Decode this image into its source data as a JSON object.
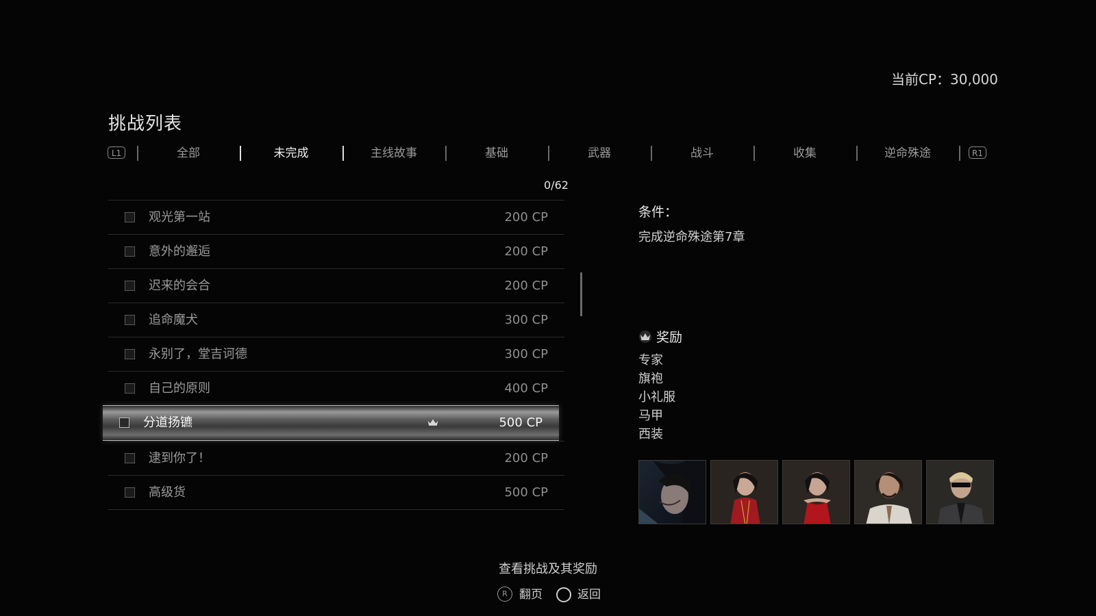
{
  "header": {
    "cp_label": "当前CP：30,000",
    "title": "挑战列表"
  },
  "tabs": {
    "left_trigger": "L1",
    "right_trigger": "R1",
    "items": [
      {
        "label": "全部",
        "active": false
      },
      {
        "label": "未完成",
        "active": true
      },
      {
        "label": "主线故事",
        "active": false
      },
      {
        "label": "基础",
        "active": false
      },
      {
        "label": "武器",
        "active": false
      },
      {
        "label": "战斗",
        "active": false
      },
      {
        "label": "收集",
        "active": false
      },
      {
        "label": "逆命殊途",
        "active": false
      }
    ]
  },
  "progress": "0/62",
  "challenges": [
    {
      "name": "观光第一站",
      "points": "200 CP",
      "selected": false
    },
    {
      "name": "意外的邂逅",
      "points": "200 CP",
      "selected": false
    },
    {
      "name": "迟来的会合",
      "points": "200 CP",
      "selected": false
    },
    {
      "name": "追命魔犬",
      "points": "300 CP",
      "selected": false
    },
    {
      "name": "永别了，堂吉诃德",
      "points": "300 CP",
      "selected": false
    },
    {
      "name": "自己的原则",
      "points": "400 CP",
      "selected": false
    },
    {
      "name": "分道扬镳",
      "points": "500 CP",
      "selected": true,
      "icon": "crown-icon"
    },
    {
      "name": "逮到你了！",
      "points": "200 CP",
      "selected": false
    },
    {
      "name": "高级货",
      "points": "500 CP",
      "selected": false
    }
  ],
  "detail": {
    "condition_label": "条件：",
    "condition_text": "完成逆命殊途第7章",
    "reward_label": "奖励",
    "rewards": [
      "专家",
      "旗袍",
      "小礼服",
      "马甲",
      "西装"
    ],
    "portraits": [
      "portrait-ada-expert",
      "portrait-ada-qipao",
      "portrait-ada-dress",
      "portrait-luis-vest",
      "portrait-wesker-suit"
    ]
  },
  "footer": {
    "hint": "查看挑战及其奖励",
    "page_stick": "R",
    "page_label": "翻页",
    "back_label": "返回"
  },
  "colors": {
    "background": "#050505",
    "text": "#cfcfcf",
    "dim_text": "#9a9a9a"
  }
}
